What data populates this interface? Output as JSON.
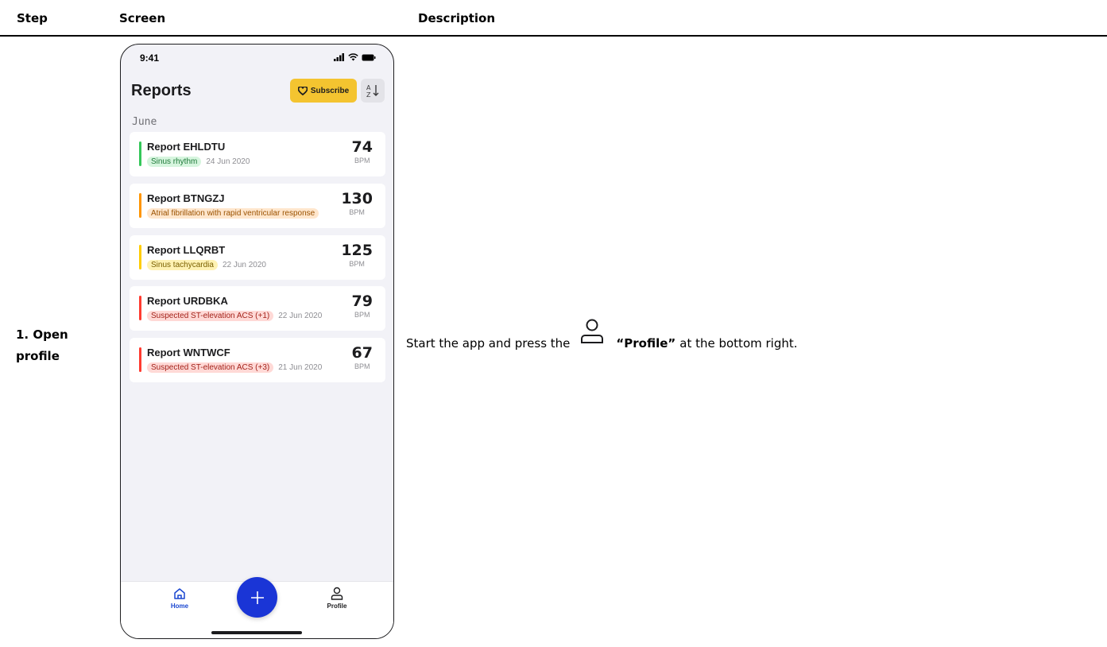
{
  "table": {
    "headers": {
      "step": "Step",
      "screen": "Screen",
      "description": "Description"
    },
    "row": {
      "step_line1": "1. Open",
      "step_line2": "profile",
      "desc_before": "Start the app and press the",
      "desc_bold": "“Profile”",
      "desc_after": "at the bottom right."
    }
  },
  "phone": {
    "status_time": "9:41",
    "title": "Reports",
    "subscribe_label": "Subscribe",
    "month": "June",
    "reports": [
      {
        "name": "Report EHLDTU",
        "tag": "Sinus rhythm",
        "date": "24 Jun 2020",
        "bpm": "74",
        "unit": "BPM",
        "color": "#34c759",
        "tag_bg": "#d6f5de",
        "tag_fg": "#1f7a3a"
      },
      {
        "name": "Report BTNGZJ",
        "tag": "Atrial fibrillation with rapid ventricular response",
        "date": "",
        "bpm": "130",
        "unit": "BPM",
        "color": "#ff9500",
        "tag_bg": "#ffe6cc",
        "tag_fg": "#9a5200"
      },
      {
        "name": "Report LLQRBT",
        "tag": "Sinus tachycardia",
        "date": "22 Jun 2020",
        "bpm": "125",
        "unit": "BPM",
        "color": "#ffcc00",
        "tag_bg": "#fff2b3",
        "tag_fg": "#7a6000"
      },
      {
        "name": "Report URDBKA",
        "tag": "Suspected ST-elevation ACS (+1)",
        "date": "22 Jun 2020",
        "bpm": "79",
        "unit": "BPM",
        "color": "#ff3b30",
        "tag_bg": "#ffd9d6",
        "tag_fg": "#a3221a"
      },
      {
        "name": "Report WNTWCF",
        "tag": "Suspected ST-elevation ACS (+3)",
        "date": "21 Jun 2020",
        "bpm": "67",
        "unit": "BPM",
        "color": "#ff3b30",
        "tag_bg": "#ffd9d6",
        "tag_fg": "#a3221a"
      }
    ],
    "tabs": {
      "home": "Home",
      "profile": "Profile"
    }
  }
}
